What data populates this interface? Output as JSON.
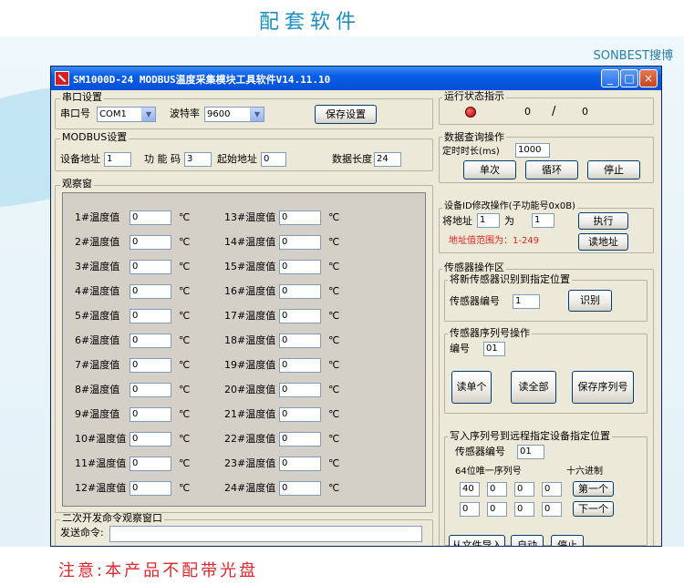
{
  "banner": {
    "title": "配套软件",
    "brand": "SONBEST搜博",
    "note": "注意:本产品不配带光盘"
  },
  "window": {
    "title": "SM1000D-24 MODBUS温度采集模块工具软件V14.11.10",
    "controls": [
      "_",
      "□",
      "×"
    ]
  },
  "serial": {
    "group": "串口设置",
    "port_label": "串口号",
    "port_value": "COM1",
    "baud_label": "波特率",
    "baud_value": "9600",
    "save_button": "保存设置"
  },
  "modbus": {
    "group": "MODBUS设置",
    "addr_label": "设备地址",
    "addr_value": "1",
    "func_label": "功 能 码",
    "func_value": "3",
    "start_label": "起始地址",
    "start_value": "0",
    "len_label": "数据长度",
    "len_value": "24"
  },
  "observe": {
    "group": "观察窗",
    "unit": "℃",
    "left_labels": [
      "1#温度值",
      "2#温度值",
      "3#温度值",
      "4#温度值",
      "5#温度值",
      "6#温度值",
      "7#温度值",
      "8#温度值",
      "9#温度值",
      "10#温度值",
      "11#温度值",
      "12#温度值"
    ],
    "right_labels": [
      "13#温度值",
      "14#温度值",
      "15#温度值",
      "16#温度值",
      "17#温度值",
      "18#温度值",
      "19#温度值",
      "20#温度值",
      "21#温度值",
      "22#温度值",
      "23#温度值",
      "24#温度值"
    ],
    "values": [
      "0",
      "0",
      "0",
      "0",
      "0",
      "0",
      "0",
      "0",
      "0",
      "0",
      "0",
      "0",
      "0",
      "0",
      "0",
      "0",
      "0",
      "0",
      "0",
      "0",
      "0",
      "0",
      "0",
      "0"
    ]
  },
  "secondary": {
    "group": "二次开发命令观察窗口",
    "send_label": "发送命令:",
    "send_value": ""
  },
  "status": {
    "group": "运行状态指示",
    "count_a": "0",
    "separator": "/",
    "count_b": "0"
  },
  "query": {
    "group": "数据查询操作",
    "timing_label": "定时时长(ms)",
    "timing_value": "1000",
    "single": "单次",
    "loop": "循环",
    "stop": "停止"
  },
  "devid": {
    "group": "设备ID修改操作(子功能号0x0B)",
    "from_label": "将地址",
    "from_value": "1",
    "to_label": "为",
    "to_value": "1",
    "execute": "执行",
    "range_text": "地址值范围为：1-249",
    "read_addr": "读地址"
  },
  "sensor": {
    "group": "传感器操作区",
    "identify_group": "将新传感器识别到指定位置",
    "id_label": "传感器编号",
    "id_value": "1",
    "identify_button": "识别",
    "serial_group": "传感器序列号操作",
    "num_label": "编号",
    "num_value": "01",
    "read_one": "读单个",
    "read_all": "读全部",
    "save_serial": "保存序列号",
    "write_group": "写入序列号到远程指定设备指定位置",
    "write_id_label": "传感器编号",
    "write_id_value": "01",
    "unique_label": "64位唯一序列号",
    "hex_label": "十六进制",
    "serial_values": [
      "40",
      "0",
      "0",
      "0",
      "0",
      "0",
      "0",
      "0"
    ],
    "first": "第一个",
    "next": "下一个",
    "import": "从文件导入",
    "auto": "自动",
    "stop": "停止"
  }
}
